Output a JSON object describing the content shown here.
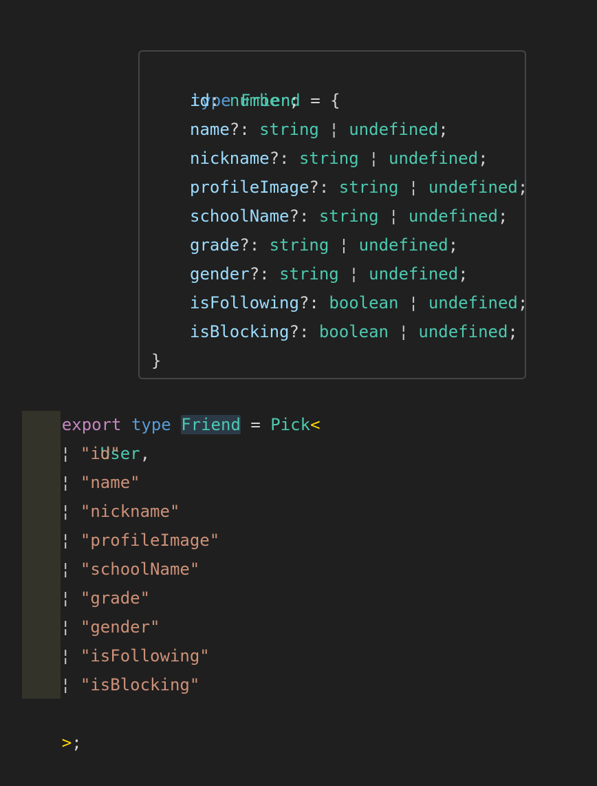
{
  "hover": {
    "header": {
      "kw": "type",
      "name": "Friend",
      "op": "= {"
    },
    "fields": [
      {
        "name": "id",
        "sep": ":",
        "type1": "number",
        "pipe": "",
        "type2": "",
        "end": ";"
      },
      {
        "name": "name",
        "sep": "?:",
        "type1": "string",
        "pipe": "¦",
        "type2": "undefined",
        "end": ";"
      },
      {
        "name": "nickname",
        "sep": "?:",
        "type1": "string",
        "pipe": "¦",
        "type2": "undefined",
        "end": ";"
      },
      {
        "name": "profileImage",
        "sep": "?:",
        "type1": "string",
        "pipe": "¦",
        "type2": "undefined",
        "end": ";"
      },
      {
        "name": "schoolName",
        "sep": "?:",
        "type1": "string",
        "pipe": "¦",
        "type2": "undefined",
        "end": ";"
      },
      {
        "name": "grade",
        "sep": "?:",
        "type1": "string",
        "pipe": "¦",
        "type2": "undefined",
        "end": ";"
      },
      {
        "name": "gender",
        "sep": "?:",
        "type1": "string",
        "pipe": "¦",
        "type2": "undefined",
        "end": ";"
      },
      {
        "name": "isFollowing",
        "sep": "?:",
        "type1": "boolean",
        "pipe": "¦",
        "type2": "undefined",
        "end": ";"
      },
      {
        "name": "isBlocking",
        "sep": "?:",
        "type1": "boolean",
        "pipe": "¦",
        "type2": "undefined",
        "end": ";"
      }
    ],
    "closing": "}"
  },
  "code": {
    "decl": {
      "export": "export",
      "type": "type",
      "name": "Friend",
      "eq": "=",
      "pick": "Pick",
      "open": "<"
    },
    "user": "User",
    "userComma": ",",
    "pipe": "¦",
    "keys": [
      "\"id\"",
      "\"name\"",
      "\"nickname\"",
      "\"profileImage\"",
      "\"schoolName\"",
      "\"grade\"",
      "\"gender\"",
      "\"isFollowing\"",
      "\"isBlocking\""
    ],
    "close": ">",
    "semi": ";"
  }
}
